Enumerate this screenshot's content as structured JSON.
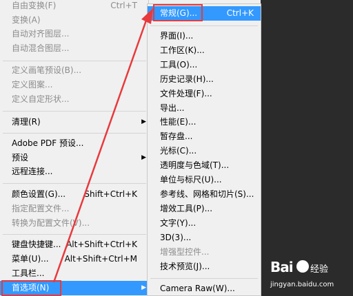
{
  "main_menu": {
    "items": [
      {
        "label": "自由变换(F)",
        "shortcut": "Ctrl+T",
        "disabled": true
      },
      {
        "label": "变换(A)",
        "disabled": true
      },
      {
        "label": "自动对齐图层...",
        "disabled": true
      },
      {
        "label": "自动混合图层...",
        "disabled": true
      },
      {
        "label": "定义画笔预设(B)...",
        "disabled": true
      },
      {
        "label": "定义图案...",
        "disabled": true
      },
      {
        "label": "定义自定形状...",
        "disabled": true
      },
      {
        "label": "清理(R)",
        "disabled": false
      },
      {
        "label": "Adobe PDF 预设...",
        "disabled": false
      },
      {
        "label": "预设",
        "disabled": false
      },
      {
        "label": "远程连接...",
        "disabled": false
      },
      {
        "label": "颜色设置(G)...",
        "shortcut": "Shift+Ctrl+K",
        "disabled": false
      },
      {
        "label": "指定配置文件...",
        "disabled": true
      },
      {
        "label": "转换为配置文件(V)...",
        "disabled": true
      },
      {
        "label": "键盘快捷键...",
        "shortcut": "Alt+Shift+Ctrl+K",
        "disabled": false
      },
      {
        "label": "菜单(U)...",
        "shortcut": "Alt+Shift+Ctrl+M",
        "disabled": false
      },
      {
        "label": "工具栏...",
        "disabled": false
      },
      {
        "label": "首选项(N)",
        "disabled": false
      }
    ]
  },
  "sub_menu": {
    "items": [
      {
        "label": "常规(G)...",
        "shortcut": "Ctrl+K"
      },
      {
        "label": "界面(I)..."
      },
      {
        "label": "工作区(K)..."
      },
      {
        "label": "工具(O)..."
      },
      {
        "label": "历史记录(H)..."
      },
      {
        "label": "文件处理(F)..."
      },
      {
        "label": "导出..."
      },
      {
        "label": "性能(E)..."
      },
      {
        "label": "暂存盘..."
      },
      {
        "label": "光标(C)..."
      },
      {
        "label": "透明度与色域(T)..."
      },
      {
        "label": "单位与标尺(U)..."
      },
      {
        "label": "参考线、网格和切片(S)..."
      },
      {
        "label": "增效工具(P)..."
      },
      {
        "label": "文字(Y)..."
      },
      {
        "label": "3D(3)..."
      },
      {
        "label": "增强型控件...",
        "disabled": true
      },
      {
        "label": "技术预览(J)..."
      },
      {
        "label": "Camera Raw(W)..."
      }
    ]
  },
  "watermark": {
    "logo": "Bai",
    "text": "经验",
    "url": "jingyan.baidu.com"
  },
  "colors": {
    "highlight": "#3399ff",
    "annotation": "#e8393d",
    "background_dark": "#2b2b2b",
    "menu_bg": "#f0f0f0"
  }
}
